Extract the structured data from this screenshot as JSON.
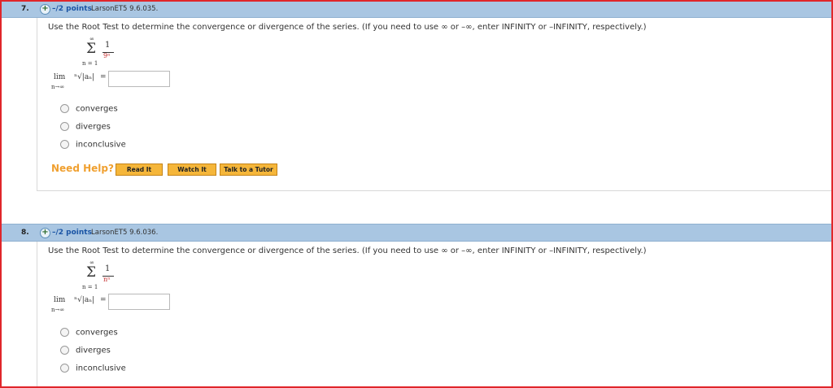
{
  "questions": [
    {
      "number": "7.",
      "expand_icon": "plus-circle-icon",
      "points": "–/2 points",
      "source": "LarsonET5 9.6.035.",
      "prompt": "Use the Root Test to determine the convergence or divergence of the series. (If you need to use ∞ or –∞, enter INFINITY or –INFINITY, respectively.)",
      "series": {
        "sigma": "Σ",
        "upper": "∞",
        "lower": "n = 1",
        "numerator": "1",
        "denominator": "9ⁿ"
      },
      "limit": {
        "lim": "lim",
        "sub": "n→∞",
        "expr": "ⁿ√|aₙ|",
        "equals": "=",
        "input_value": ""
      },
      "options": [
        "converges",
        "diverges",
        "inconclusive"
      ],
      "help": {
        "label": "Need Help?",
        "buttons": [
          "Read It",
          "Watch It",
          "Talk to a Tutor"
        ]
      }
    },
    {
      "number": "8.",
      "expand_icon": "plus-circle-icon",
      "points": "–/2 points",
      "source": "LarsonET5 9.6.036.",
      "prompt": "Use the Root Test to determine the convergence or divergence of the series. (If you need to use ∞ or –∞, enter INFINITY or –INFINITY, respectively.)",
      "series": {
        "sigma": "Σ",
        "upper": "∞",
        "lower": "n = 1",
        "numerator": "1",
        "denominator": "nⁿ"
      },
      "limit": {
        "lim": "lim",
        "sub": "n→∞",
        "expr": "ⁿ√|aₙ|",
        "equals": "=",
        "input_value": ""
      },
      "options": [
        "converges",
        "diverges",
        "inconclusive"
      ]
    }
  ]
}
